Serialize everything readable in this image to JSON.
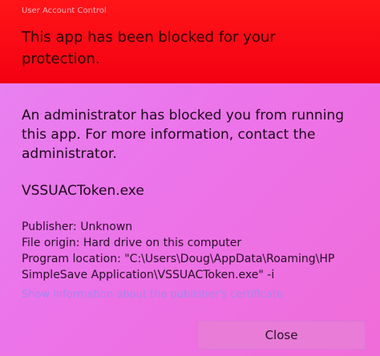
{
  "window": {
    "caption": "User Account Control"
  },
  "header": {
    "title": "This app has been blocked for your protection."
  },
  "main": {
    "message": "An administrator has blocked you from running this app. For more information, contact the administrator.",
    "app_name": "VSSUACToken.exe",
    "details": [
      "Publisher: Unknown",
      "File origin: Hard drive on this computer",
      "Program location: \"C:\\Users\\Doug\\AppData\\Roaming\\HP",
      "SimpleSave Application\\VSSUACToken.exe\" -i"
    ],
    "certificate_link": "Show information about the publisher's certificate"
  },
  "footer": {
    "close_label": "Close"
  },
  "colors": {
    "header_red": "#f40012",
    "body_magenta": "#ec74ea",
    "link": "#9a8af0"
  }
}
